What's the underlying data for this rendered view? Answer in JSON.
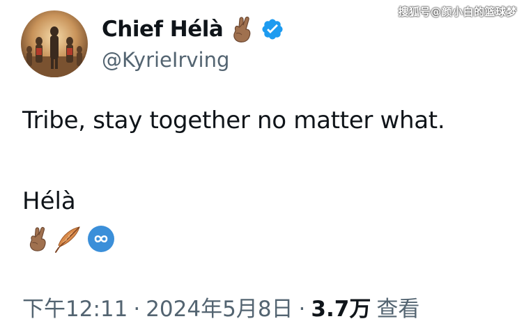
{
  "watermark": "搜狐号@颜小白的篮球梦",
  "author": {
    "display_name": "Chief Hélà",
    "handle": "@KyrieIrving",
    "verified": true,
    "name_emoji": "crossed-fingers-icon",
    "avatar": "profile-avatar"
  },
  "tweet": {
    "text": "Tribe, stay together no matter what.",
    "signature": "Hélà",
    "emojis": [
      "crossed-fingers-icon",
      "feather-icon",
      "infinity-icon"
    ]
  },
  "meta": {
    "time": "下午12:11",
    "separator": "·",
    "date": "2024年5月8日",
    "views_count": "3.7万",
    "views_label": "查看"
  },
  "colors": {
    "text": "#0f1419",
    "secondary": "#536471",
    "verified_badge": "#1d9bf0",
    "skin_tone": "#a0714f",
    "infinity_bg": "#3b8fd9"
  }
}
